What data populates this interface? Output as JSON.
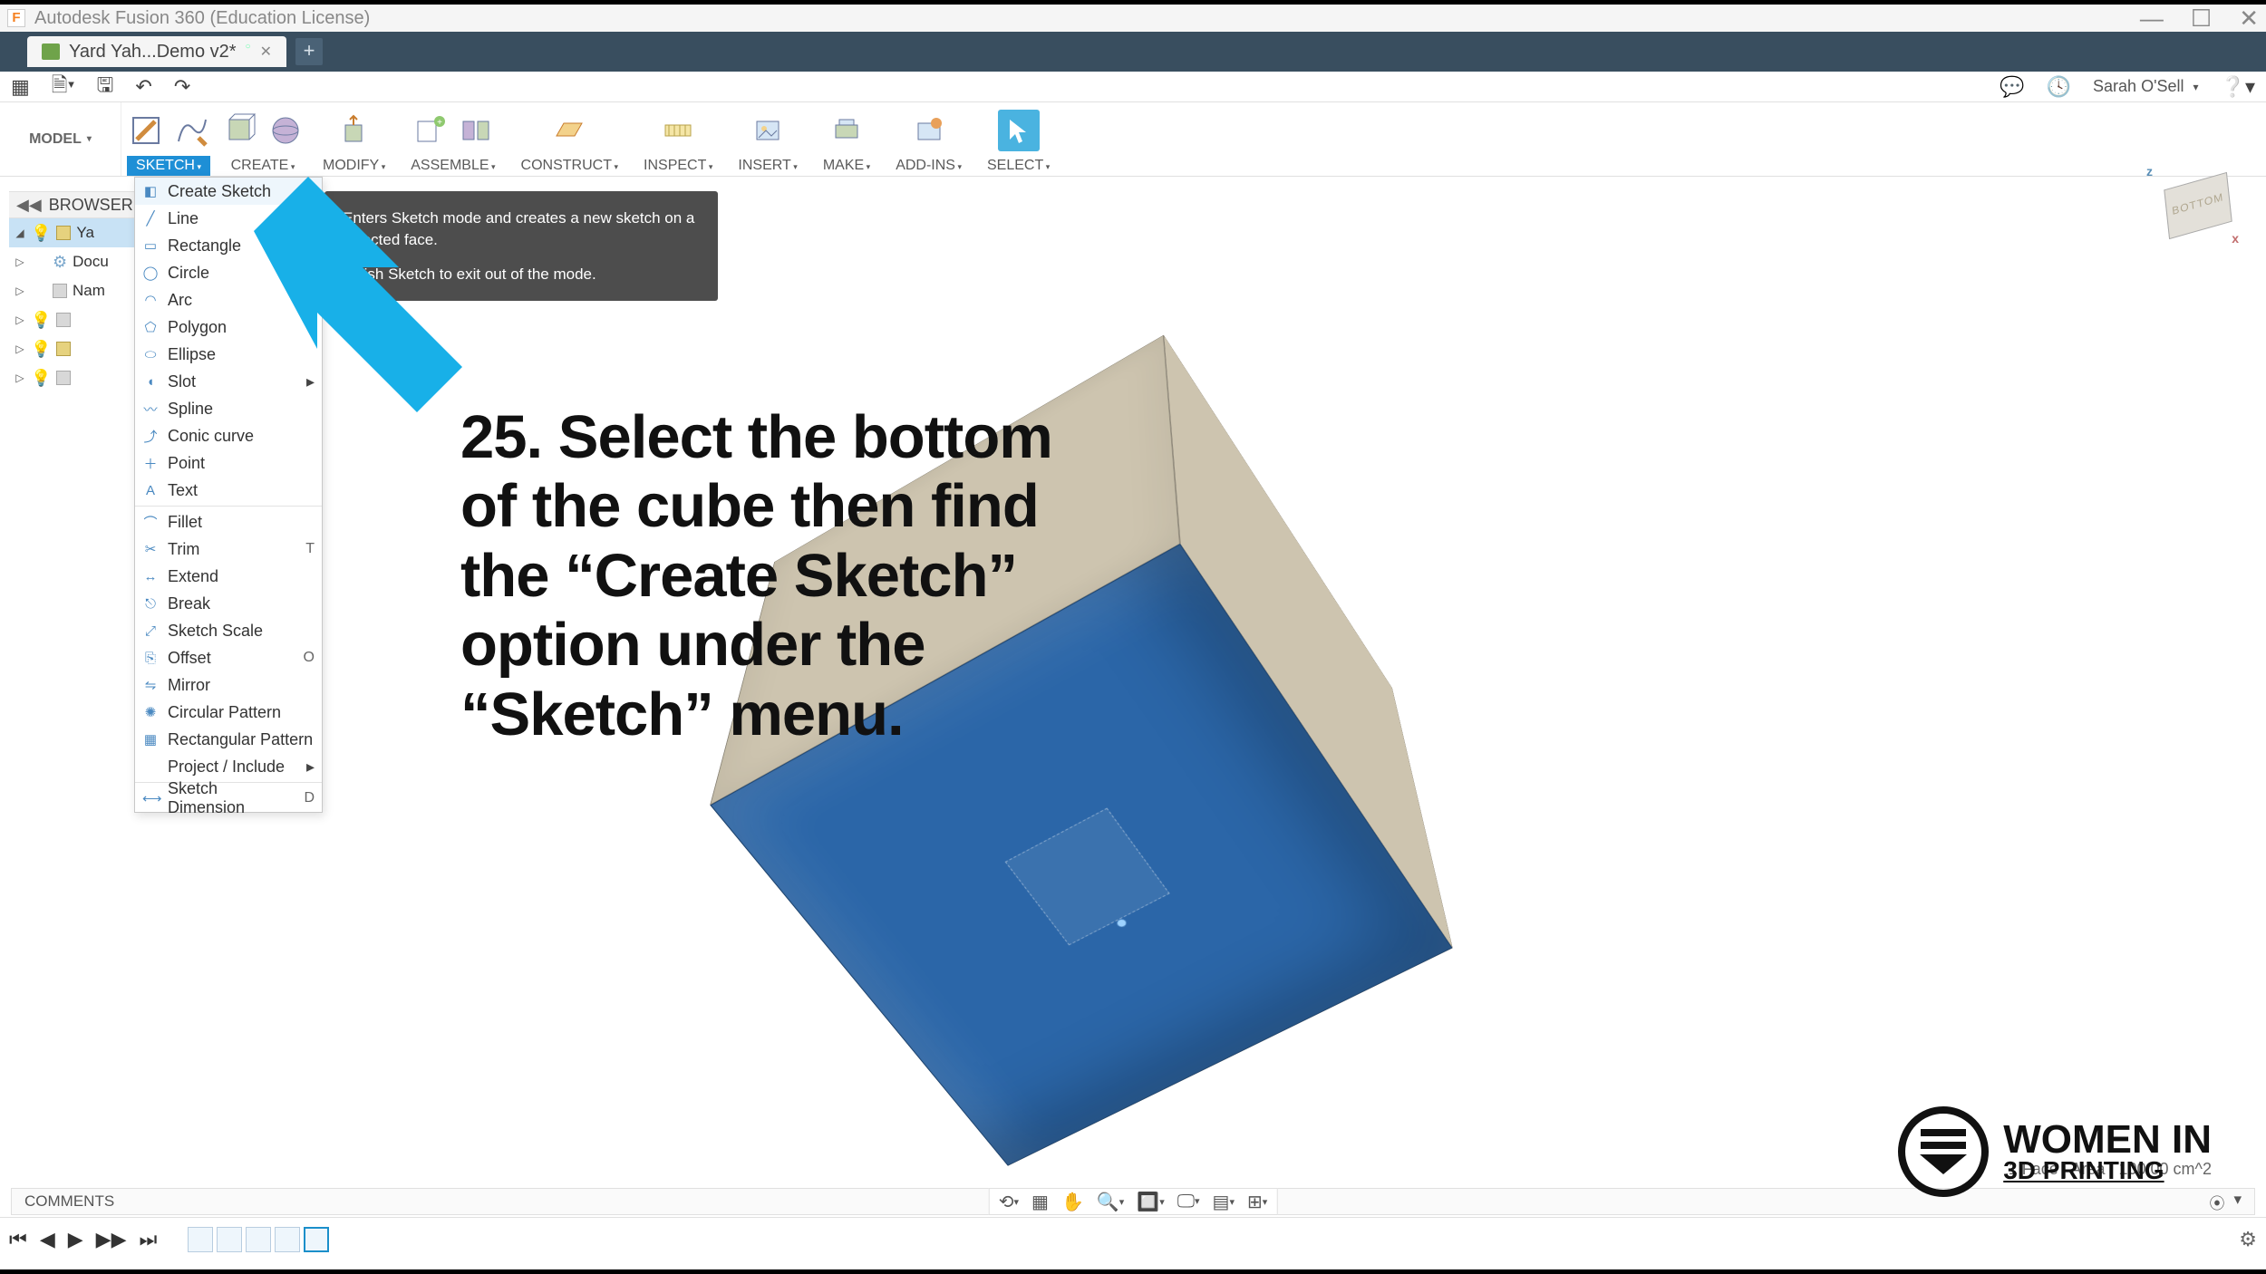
{
  "titlebar": {
    "app_title": "Autodesk Fusion 360 (Education License)"
  },
  "tabs": {
    "file_tab_label": "Yard Yah...Demo v2*"
  },
  "quickbar": {
    "user": "Sarah O'Sell"
  },
  "ribbon": {
    "model": "MODEL",
    "groups": [
      "SKETCH",
      "CREATE",
      "MODIFY",
      "ASSEMBLE",
      "CONSTRUCT",
      "INSPECT",
      "INSERT",
      "MAKE",
      "ADD-INS",
      "SELECT"
    ]
  },
  "browser": {
    "header": "BROWSER",
    "rows": [
      {
        "exp": "◢",
        "bulb": true,
        "icon": "box",
        "label": "Ya",
        "sel": true
      },
      {
        "exp": "▷",
        "bulb": false,
        "icon": "gear",
        "label": "Docu"
      },
      {
        "exp": "▷",
        "bulb": false,
        "icon": "box-gray",
        "label": "Nam"
      },
      {
        "exp": "▷",
        "bulb": true,
        "icon": "box-gray",
        "label": ""
      },
      {
        "exp": "▷",
        "bulb": true,
        "icon": "box",
        "label": ""
      },
      {
        "exp": "▷",
        "bulb": true,
        "icon": "box-gray",
        "label": ""
      }
    ]
  },
  "sketch_menu": {
    "items": [
      {
        "name": "create-sketch",
        "label": "Create Sketch",
        "highlight": true,
        "dots": true
      },
      {
        "name": "line",
        "label": "Line"
      },
      {
        "name": "rectangle",
        "label": "Rectangle"
      },
      {
        "name": "circle",
        "label": "Circle"
      },
      {
        "name": "arc",
        "label": "Arc"
      },
      {
        "name": "polygon",
        "label": "Polygon"
      },
      {
        "name": "ellipse",
        "label": "Ellipse"
      },
      {
        "name": "slot",
        "label": "Slot",
        "arrow": true
      },
      {
        "name": "spline",
        "label": "Spline"
      },
      {
        "name": "conic-curve",
        "label": "Conic curve"
      },
      {
        "name": "point",
        "label": "Point"
      },
      {
        "name": "text",
        "label": "Text"
      },
      {
        "sep": true
      },
      {
        "name": "fillet",
        "label": "Fillet"
      },
      {
        "name": "trim",
        "label": "Trim",
        "shortcut": "T"
      },
      {
        "name": "extend",
        "label": "Extend"
      },
      {
        "name": "break",
        "label": "Break"
      },
      {
        "name": "sketch-scale",
        "label": "Sketch Scale"
      },
      {
        "name": "offset",
        "label": "Offset",
        "shortcut": "O"
      },
      {
        "name": "mirror",
        "label": "Mirror"
      },
      {
        "name": "circular-pattern",
        "label": "Circular Pattern"
      },
      {
        "name": "rectangular-pattern",
        "label": "Rectangular Pattern"
      },
      {
        "name": "project-include",
        "label": "Project / Include",
        "arrow": true
      },
      {
        "sep": true
      },
      {
        "name": "sketch-dimension",
        "label": "Sketch Dimension",
        "shortcut": "D"
      }
    ]
  },
  "tooltip": {
    "line1": "Enters Sketch mode and creates a new sketch on a selected face.",
    "line2": "Finish Sketch to exit out of the mode."
  },
  "instruction": "25. Select the bottom of the cube then find the “Create Sketch” option under the “Sketch” menu.",
  "nav_tools": [
    "orbit",
    "fit",
    "pan",
    "zoom",
    "zoom-window",
    "display",
    "grid",
    "viewports"
  ],
  "comment_bar": {
    "label": "COMMENTS"
  },
  "status": "1 Face | Area : 100.00 cm^2",
  "viewcube": {
    "label": "BOTTOM"
  },
  "watermark": {
    "line1": "WOMEN IN",
    "line2": "3D PRINTING"
  }
}
